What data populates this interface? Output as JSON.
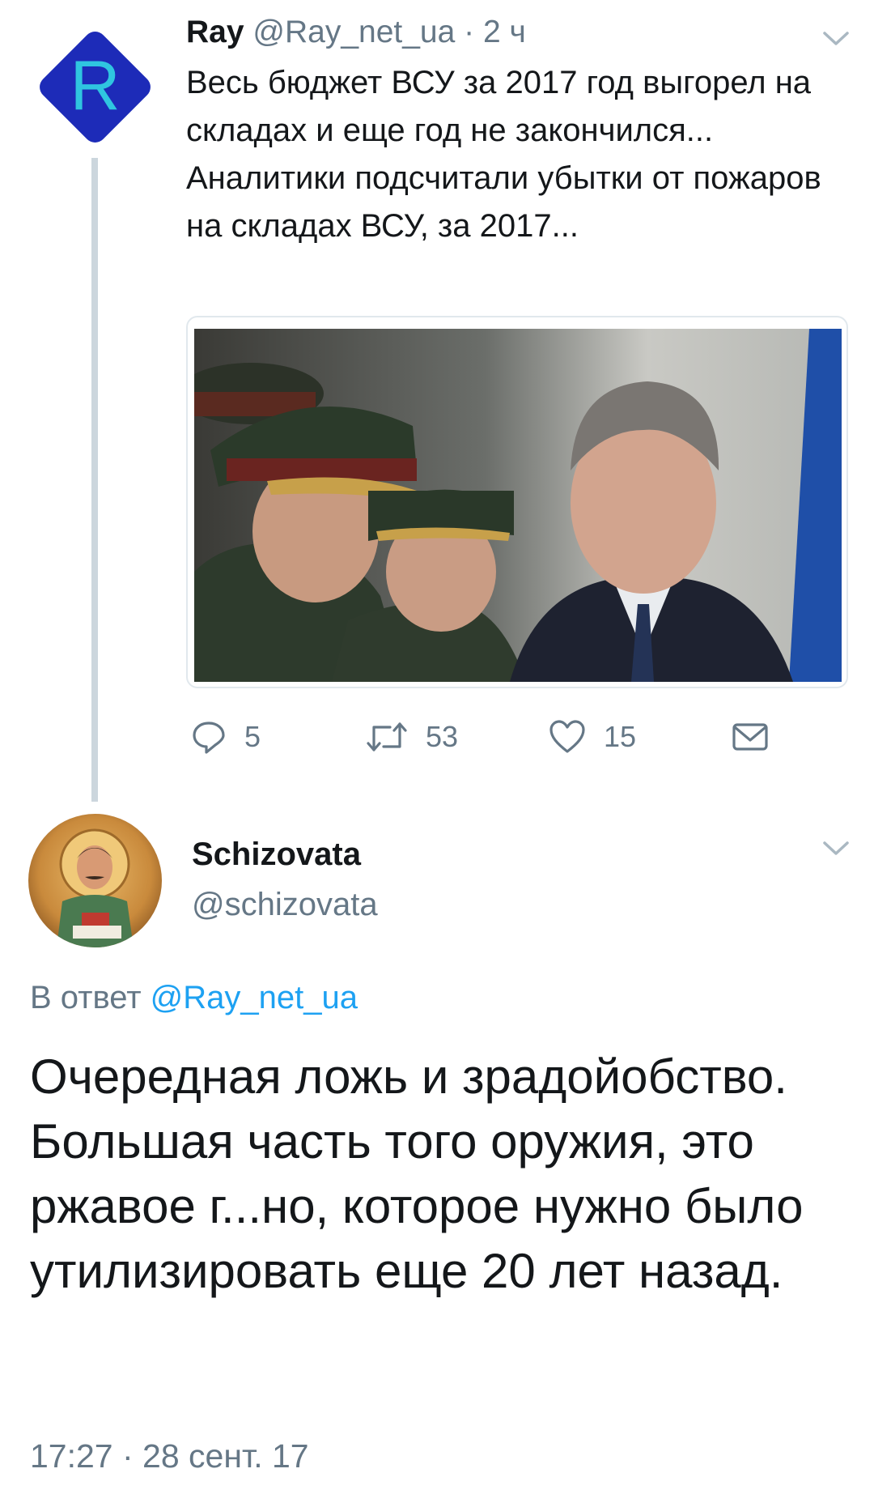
{
  "original_tweet": {
    "author_name": "Ray",
    "author_handle": "@Ray_net_ua",
    "separator": "·",
    "time_ago": "2 ч",
    "avatar_letter": "R",
    "text_lines": [
      "Весь бюджет ВСУ за 2017 год выгорел на складах и еще год не закончился...",
      "Аналитики подсчитали убытки от пожаров на складах ВСУ, за 2017..."
    ],
    "stats": {
      "replies": "5",
      "retweets": "53",
      "likes": "15"
    }
  },
  "reply_tweet": {
    "author_name": "Schizovata",
    "author_handle": "@schizovata",
    "reply_prefix": "В ответ",
    "reply_to_handle": "@Ray_net_ua",
    "text": "Очередная ложь и зрадойобство. Большая часть того оружия, это ржавое г...но, которое нужно было утилизировать еще 20 лет назад.",
    "timestamp": "17:27 · 28 сент. 17"
  },
  "colors": {
    "primary_text": "#14171a",
    "secondary_text": "#657786",
    "link": "#1da1f2",
    "thread_line": "#ccd6dd",
    "ray_avatar_bg": "#1d2bb8",
    "ray_avatar_letter": "#2fc5e0"
  },
  "icons": {
    "reply": "reply-icon",
    "retweet": "retweet-icon",
    "like": "heart-icon",
    "dm": "envelope-icon",
    "more": "chevron-down-icon"
  }
}
